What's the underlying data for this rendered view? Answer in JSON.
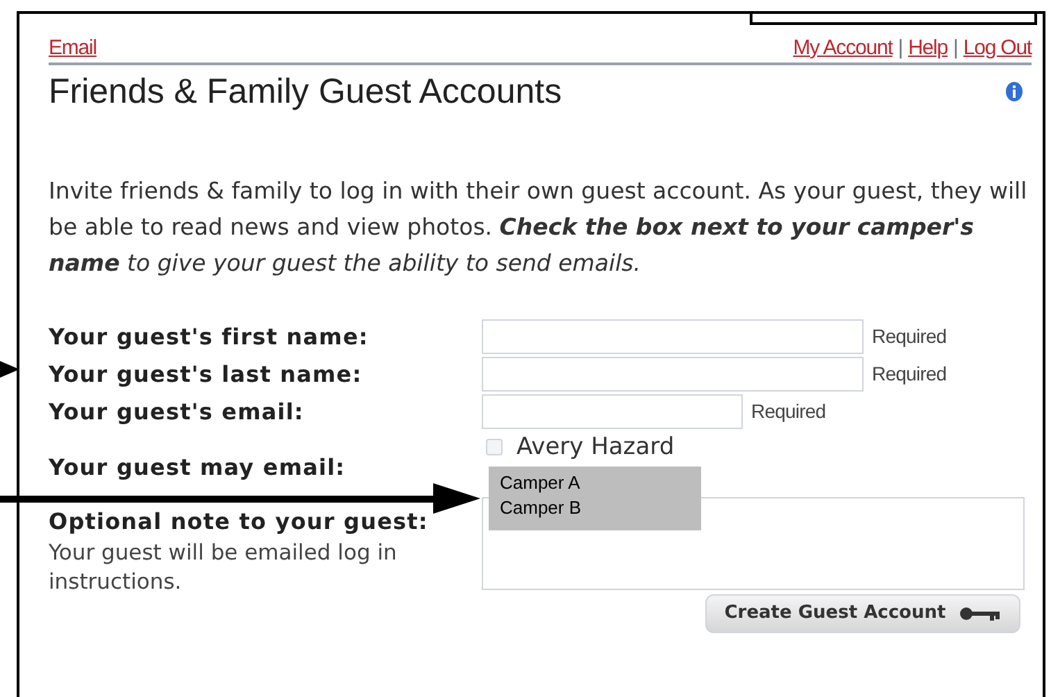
{
  "top_links": {
    "left": "Email",
    "right": [
      "My Account",
      "Help",
      "Log Out"
    ],
    "separator": "|"
  },
  "title": "Friends & Family Guest Accounts",
  "intro": [
    {
      "text": "Invite friends & family to log in with their own guest account. As your guest, they will be able to read news and view photos. ",
      "kind": "plain"
    },
    {
      "text": "Check the box next to your camper's name",
      "kind": "emphasis"
    },
    {
      "text": " to give your guest the ability to send emails.",
      "kind": "aside"
    }
  ],
  "form": [
    {
      "kind": "text",
      "label": "Your guest's first name:",
      "hint": "Required"
    },
    {
      "kind": "text",
      "label": "Your guest's last name:",
      "hint": "Required"
    },
    {
      "kind": "email",
      "label": "Your guest's email:",
      "hint": "Required"
    },
    {
      "kind": "checkboxes",
      "label": "Your guest may email:",
      "options": [
        {
          "label": "Avery Hazard",
          "checked": false
        }
      ]
    },
    {
      "kind": "textarea",
      "label": "Optional note to your guest:",
      "note": "Your guest will be emailed log in instructions."
    }
  ],
  "submit": "Create Guest Account",
  "overlay": {
    "items": [
      "Camper A",
      "Camper B"
    ]
  }
}
